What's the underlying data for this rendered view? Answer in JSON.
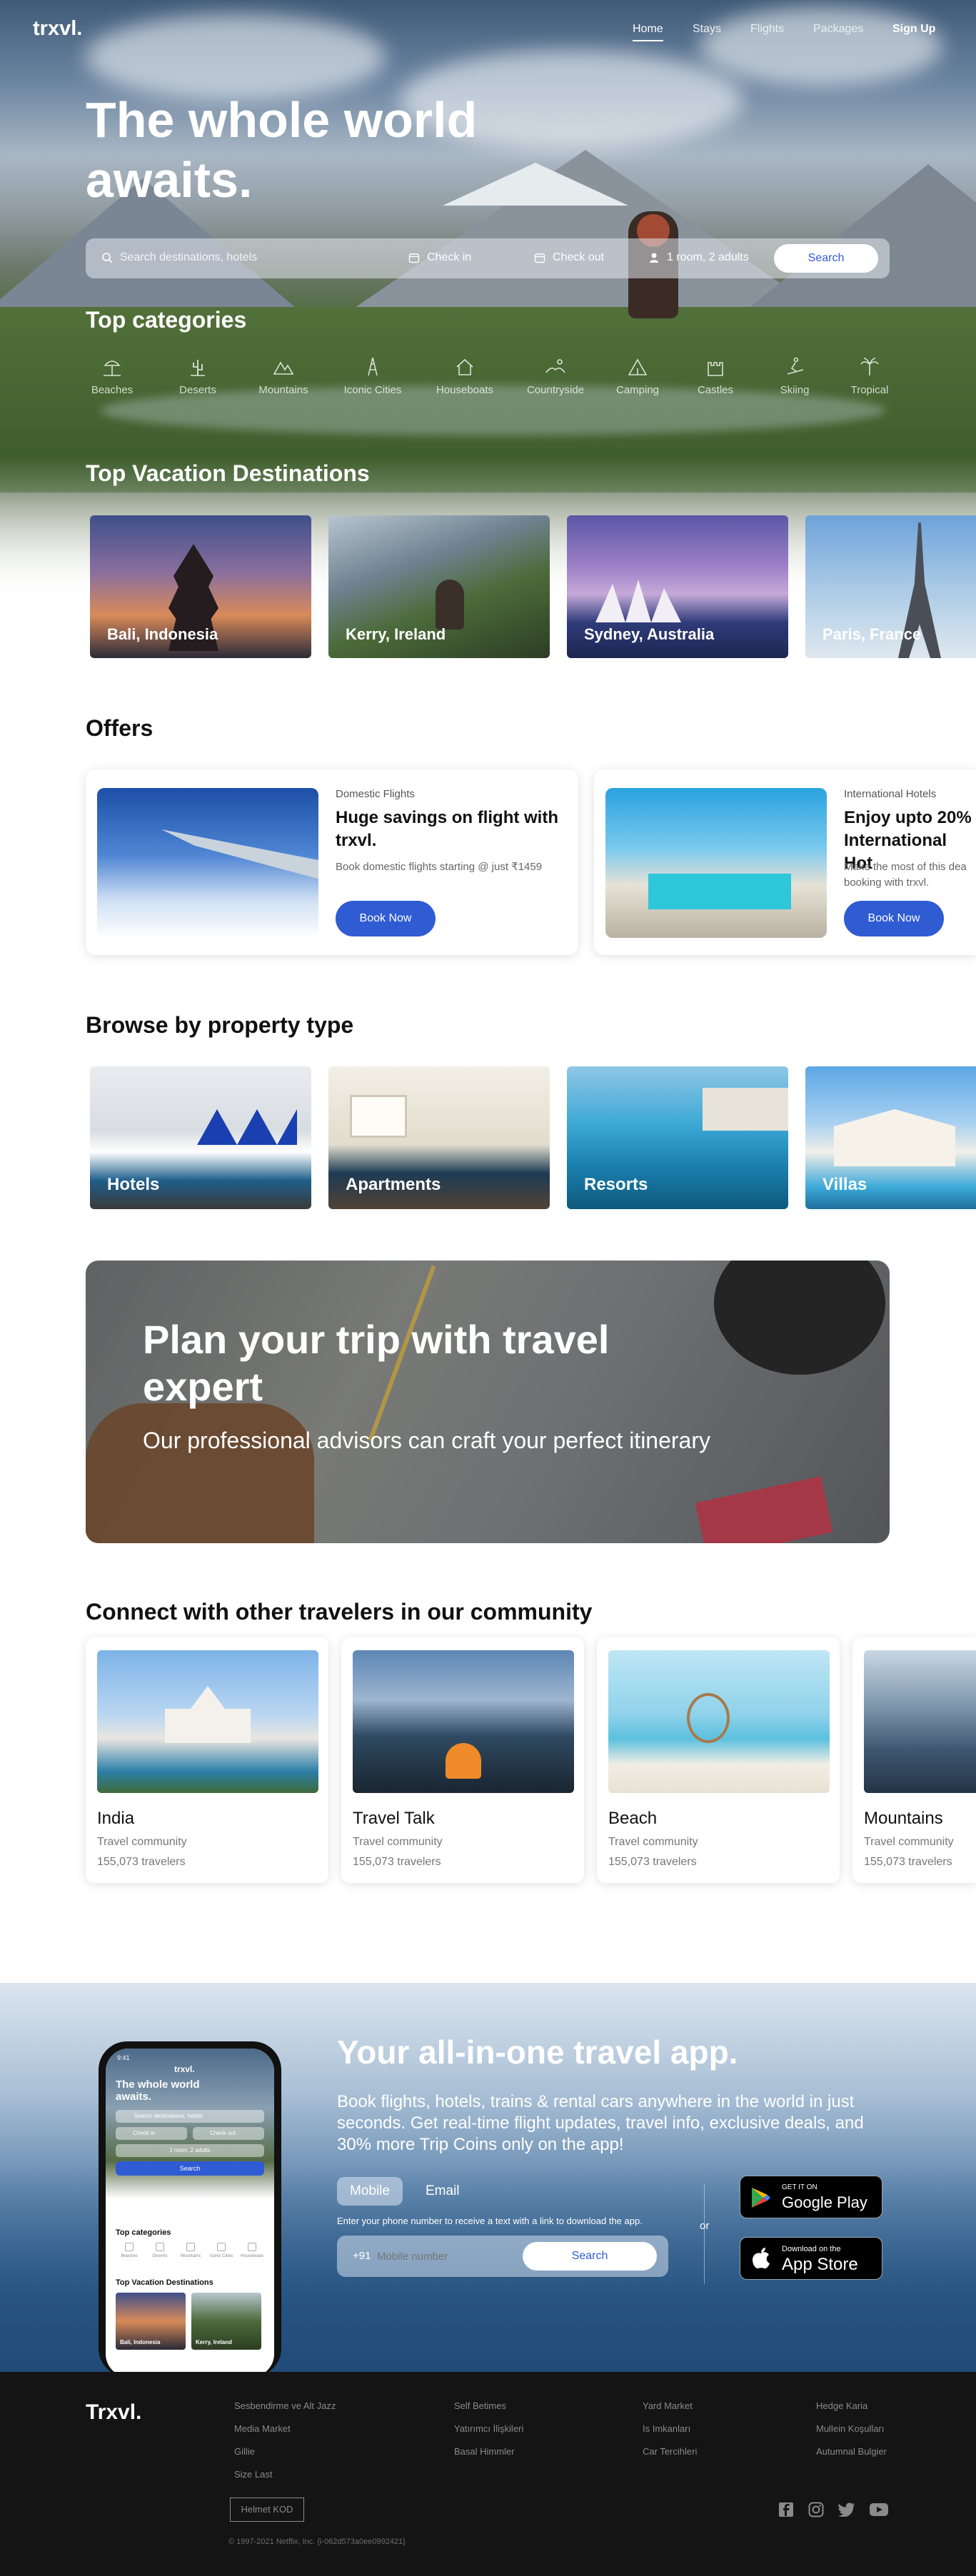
{
  "header": {
    "brand": "trxvl.",
    "nav": [
      "Home",
      "Stays",
      "Flights",
      "Packages",
      "Sign Up"
    ]
  },
  "hero": {
    "title_line1": "The whole world",
    "title_line2": "awaits."
  },
  "search": {
    "placeholder": "Search destinations, hotels",
    "check_in": "Check in",
    "check_out": "Check out",
    "guests": "1 room, 2 adults",
    "button": "Search"
  },
  "categories": {
    "title": "Top categories",
    "items": [
      "Beaches",
      "Deserts",
      "Mountains",
      "Iconic Cities",
      "Houseboats",
      "Countryside",
      "Camping",
      "Castles",
      "Skiing",
      "Tropical"
    ]
  },
  "destinations": {
    "title": "Top Vacation Destinations",
    "items": [
      "Bali, Indonesia",
      "Kerry, Ireland",
      "Sydney, Australia",
      "Paris, France"
    ]
  },
  "offers": {
    "title": "Offers",
    "items": [
      {
        "kind": "Domestic Flights",
        "title": "Huge savings on flight with trxvl.",
        "desc": "Book domestic flights starting @ just ₹1459",
        "button": "Book Now"
      },
      {
        "kind": "International Hotels",
        "title": "Enjoy upto 20% International Hot",
        "desc": "Make the most of  this dea booking with trxvl.",
        "button": "Book Now"
      }
    ]
  },
  "property": {
    "title": "Browse by property type",
    "items": [
      "Hotels",
      "Apartments",
      "Resorts",
      "Villas"
    ]
  },
  "plan": {
    "title": "Plan your trip with travel expert",
    "subtitle": "Our professional advisors can craft your perfect itinerary"
  },
  "community": {
    "title": "Connect with other travelers in our community",
    "items": [
      {
        "name": "India",
        "sub": "Travel community",
        "count": "155,073 travelers"
      },
      {
        "name": "Travel Talk",
        "sub": "Travel community",
        "count": "155,073 travelers"
      },
      {
        "name": "Beach",
        "sub": "Travel community",
        "count": "155,073 travelers"
      },
      {
        "name": "Mountains",
        "sub": "Travel community",
        "count": "155,073 travelers"
      }
    ]
  },
  "app": {
    "title": "Your all-in-one travel app.",
    "desc": "Book flights, hotels, trains & rental cars anywhere in the world in just seconds. Get real-time flight updates, travel info, exclusive deals, and 30% more Trip Coins only on the app!",
    "tab_mobile": "Mobile",
    "tab_email": "Email",
    "hint": "Enter your phone number to receive a text with a link to download the app.",
    "prefix": "+91",
    "placeholder": "Mobile number",
    "button": "Search",
    "or": "or",
    "google_small": "GET IT ON",
    "google_big": "Google Play",
    "apple_small": "Download on the",
    "apple_big": "App Store"
  },
  "phone": {
    "time": "9:41",
    "brand": "trxvl.",
    "title": "The whole world awaits.",
    "search": "Search destinations, hotels",
    "check_in": "Check in",
    "check_out": "Check out",
    "guests": "1 room, 2 adults",
    "button": "Search",
    "cat_title": "Top categories",
    "cats": [
      "Beaches",
      "Deserts",
      "Mountains",
      "Iconic Cities",
      "Houseboats"
    ],
    "dest_title": "Top Vacation Destinations",
    "dests": [
      "Bali, Indonesia",
      "Kerry, Ireland"
    ]
  },
  "footer": {
    "logo": "Trxvl.",
    "col1": [
      "Sesbendirme ve Alt Jazz",
      "Media Market",
      "Gillie",
      "Size Last"
    ],
    "col2": [
      "Self Betimes",
      "Yatırımcı İlişkileri",
      "Basal Himmler"
    ],
    "col3": [
      "Yard Market",
      "Is Imkanları",
      "Car Tercihleri"
    ],
    "col4": [
      "Hedge Karia",
      "Mullein Koşulları",
      "Autumnal Bulgier"
    ],
    "button": "Helmet KOD",
    "copyright": "© 1997-2021 Netflix, Inc. {i-062d573a0ee0992421}"
  }
}
